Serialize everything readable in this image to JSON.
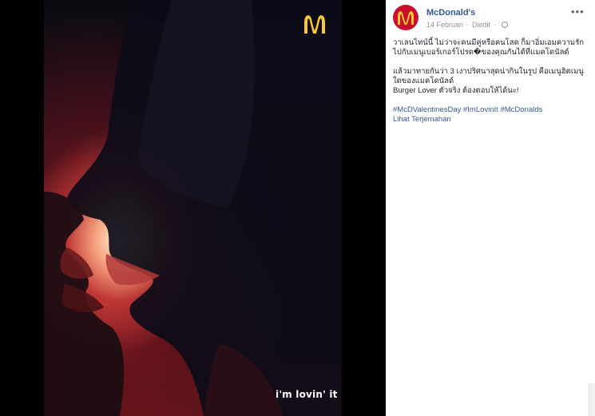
{
  "photo": {
    "logo_icon": "mcdonalds-golden-arches-icon",
    "slogan": "i'm lovin' it"
  },
  "post": {
    "page_name": "McDonald's",
    "avatar_icon": "mcdonalds-logo-icon",
    "date": "14 Februari",
    "edited": "Diedit",
    "privacy_icon": "globe-icon",
    "more_icon": "more-options-icon",
    "caption": {
      "p1_l1": "วาเลนไทน์นี้ ไม่ว่าจะคนมีคู่หรือคนโสด ก็มาอิ่มเอมความรัก",
      "p1_l2": "ไปกับเมนูเบอร์เกอร์โปรด�ของคุณกันได้ที่แมคโดนัลด์",
      "p2_l1": "แล้วมาทายกันว่า 3 เงาปริศนาสุดน่ากินในรูป คือเมนูฮิตเมนู",
      "p2_l2": "ใดของแมคโดนัลด์",
      "p2_l3": "Burger Lover ตัวจริง ต้องตอบให้ได้นะ!",
      "hashtags": "#McDValentinesDay #ImLovinIt #McDonalds",
      "translate": "Lihat Terjemahan"
    }
  },
  "colors": {
    "brand_red": "#c8102e",
    "brand_yellow": "#ffc72c",
    "link_blue": "#365899"
  }
}
